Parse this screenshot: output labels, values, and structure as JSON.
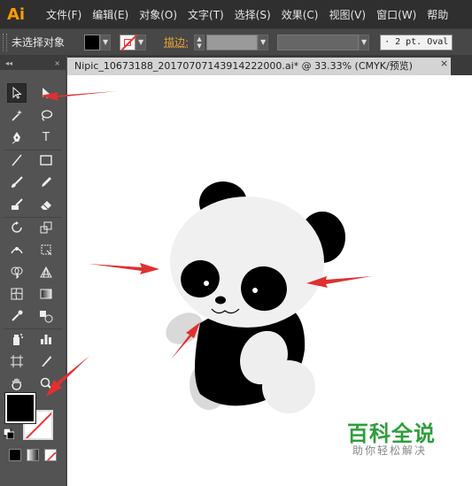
{
  "menubar": {
    "logo": "Ai",
    "items": [
      "文件(F)",
      "编辑(E)",
      "对象(O)",
      "文字(T)",
      "选择(S)",
      "效果(C)",
      "视图(V)",
      "窗口(W)",
      "帮助"
    ]
  },
  "controlbar": {
    "selection_status": "未选择对象",
    "stroke_label": "描边:",
    "brush_value": "· 2 pt. Oval"
  },
  "toolbar": {
    "collapse_glyph": "◂◂",
    "close_glyph": "×",
    "tools": [
      "selection-tool",
      "direct-selection-tool",
      "magic-wand-tool",
      "lasso-tool",
      "pen-tool",
      "type-tool",
      "line-segment-tool",
      "rectangle-tool",
      "paintbrush-tool",
      "pencil-tool",
      "blob-brush-tool",
      "eraser-tool",
      "rotate-tool",
      "scale-tool",
      "width-tool",
      "free-transform-tool",
      "shape-builder-tool",
      "perspective-grid-tool",
      "mesh-tool",
      "gradient-tool",
      "eyedropper-tool",
      "blend-tool",
      "symbol-sprayer-tool",
      "column-graph-tool",
      "artboard-tool",
      "slice-tool",
      "hand-tool",
      "zoom-tool"
    ],
    "type_tool_glyph": "T"
  },
  "document": {
    "tab_title": "Nipic_10673188_20170707143914222000.ai* @ 33.33% (CMYK/预览)",
    "close_glyph": "×"
  },
  "watermark": {
    "title": "百科全说",
    "subtitle": "助你轻松解决"
  },
  "colors": {
    "accent": "#ff9a00",
    "arrow": "#e03030",
    "watermark_green": "#2e9e3a"
  }
}
